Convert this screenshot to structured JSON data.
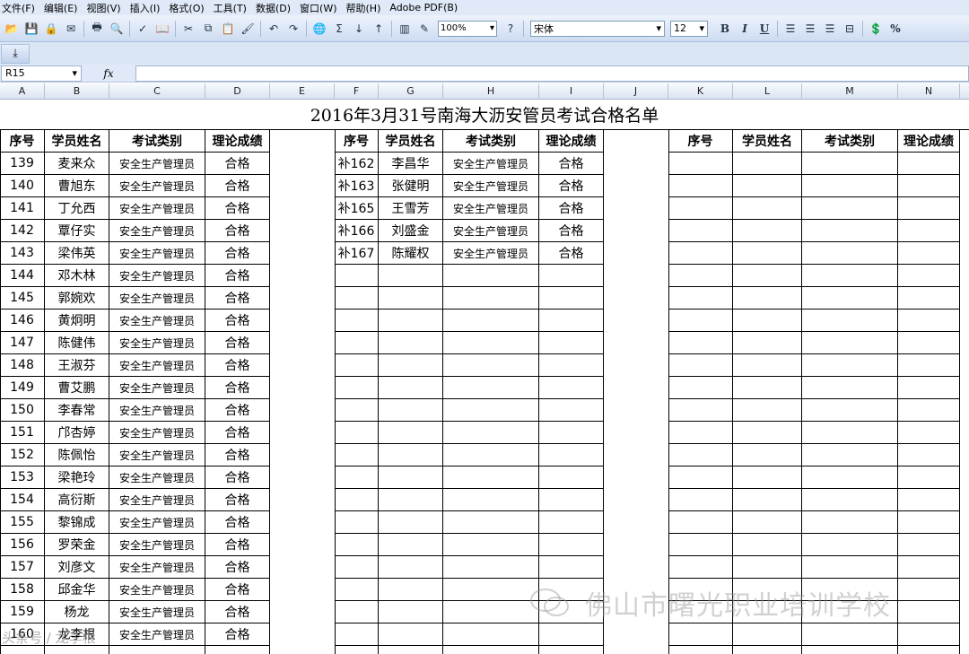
{
  "menu": [
    "文件(F)",
    "编辑(E)",
    "视图(V)",
    "插入(I)",
    "格式(O)",
    "工具(T)",
    "数据(D)",
    "窗口(W)",
    "帮助(H)",
    "Adobe PDF(B)"
  ],
  "toolbar": {
    "zoom": "100%",
    "font": "宋体",
    "size": "12",
    "bold": "B",
    "italic": "I",
    "underline": "U",
    "percent": "%"
  },
  "formula": {
    "cell_ref": "R15",
    "fx": "fx",
    "value": ""
  },
  "columns": [
    "A",
    "B",
    "C",
    "D",
    "E",
    "F",
    "G",
    "H",
    "I",
    "J",
    "K",
    "L",
    "M",
    "N"
  ],
  "sheet": {
    "title": "2016年3月31号南海大沥安管员考试合格名单",
    "headers": [
      "序号",
      "学员姓名",
      "考试类别",
      "理论成绩"
    ],
    "left_rows": [
      [
        "139",
        "麦来众",
        "安全生产管理员",
        "合格"
      ],
      [
        "140",
        "曹旭东",
        "安全生产管理员",
        "合格"
      ],
      [
        "141",
        "丁允西",
        "安全生产管理员",
        "合格"
      ],
      [
        "142",
        "覃仔实",
        "安全生产管理员",
        "合格"
      ],
      [
        "143",
        "梁伟英",
        "安全生产管理员",
        "合格"
      ],
      [
        "144",
        "邓木林",
        "安全生产管理员",
        "合格"
      ],
      [
        "145",
        "郭婉欢",
        "安全生产管理员",
        "合格"
      ],
      [
        "146",
        "黄炯明",
        "安全生产管理员",
        "合格"
      ],
      [
        "147",
        "陈健伟",
        "安全生产管理员",
        "合格"
      ],
      [
        "148",
        "王淑芬",
        "安全生产管理员",
        "合格"
      ],
      [
        "149",
        "曹艾鹏",
        "安全生产管理员",
        "合格"
      ],
      [
        "150",
        "李春常",
        "安全生产管理员",
        "合格"
      ],
      [
        "151",
        "邝杏婷",
        "安全生产管理员",
        "合格"
      ],
      [
        "152",
        "陈佩怡",
        "安全生产管理员",
        "合格"
      ],
      [
        "153",
        "梁艳玲",
        "安全生产管理员",
        "合格"
      ],
      [
        "154",
        "高衍斯",
        "安全生产管理员",
        "合格"
      ],
      [
        "155",
        "黎锦成",
        "安全生产管理员",
        "合格"
      ],
      [
        "156",
        "罗荣金",
        "安全生产管理员",
        "合格"
      ],
      [
        "157",
        "刘彦文",
        "安全生产管理员",
        "合格"
      ],
      [
        "158",
        "邱金华",
        "安全生产管理员",
        "合格"
      ],
      [
        "159",
        "杨龙",
        "安全生产管理员",
        "合格"
      ],
      [
        "160",
        "龙李根",
        "安全生产管理员",
        "合格"
      ]
    ],
    "mid_rows": [
      [
        "补162",
        "李昌华",
        "安全生产管理员",
        "合格"
      ],
      [
        "补163",
        "张健明",
        "安全生产管理员",
        "合格"
      ],
      [
        "补165",
        "王雪芳",
        "安全生产管理员",
        "合格"
      ],
      [
        "补166",
        "刘盛金",
        "安全生产管理员",
        "合格"
      ],
      [
        "补167",
        "陈耀权",
        "安全生产管理员",
        "合格"
      ]
    ]
  },
  "watermark": "佛山市曙光职业培训学校",
  "watermark_small": "头条号 / 龙李根"
}
